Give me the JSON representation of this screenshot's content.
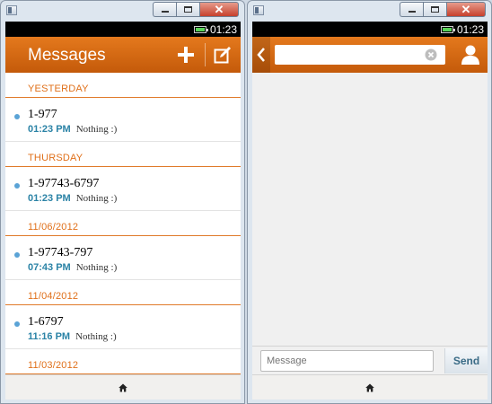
{
  "status": {
    "time": "01:23"
  },
  "inbox": {
    "title": "Messages",
    "groups": [
      {
        "date": "YESTERDAY",
        "number": "1-977",
        "time": "01:23 PM",
        "preview": "Nothing :)"
      },
      {
        "date": "THURSDAY",
        "number": "1-97743-6797",
        "time": "01:23 PM",
        "preview": "Nothing :)"
      },
      {
        "date": "11/06/2012",
        "number": "1-97743-797",
        "time": "07:43 PM",
        "preview": "Nothing :)"
      },
      {
        "date": "11/04/2012",
        "number": "1-6797",
        "time": "11:16 PM",
        "preview": "Nothing :)"
      },
      {
        "date": "11/03/2012"
      }
    ]
  },
  "conversation": {
    "to_value": "",
    "message_placeholder": "Message",
    "send_label": "Send"
  },
  "colors": {
    "accent": "#d96a12",
    "link": "#2b83a6",
    "unread_dot": "#5aa3d6"
  },
  "icons": [
    "plus-icon",
    "compose-icon",
    "back-icon",
    "clear-icon",
    "contact-icon",
    "home-icon",
    "battery-icon"
  ]
}
